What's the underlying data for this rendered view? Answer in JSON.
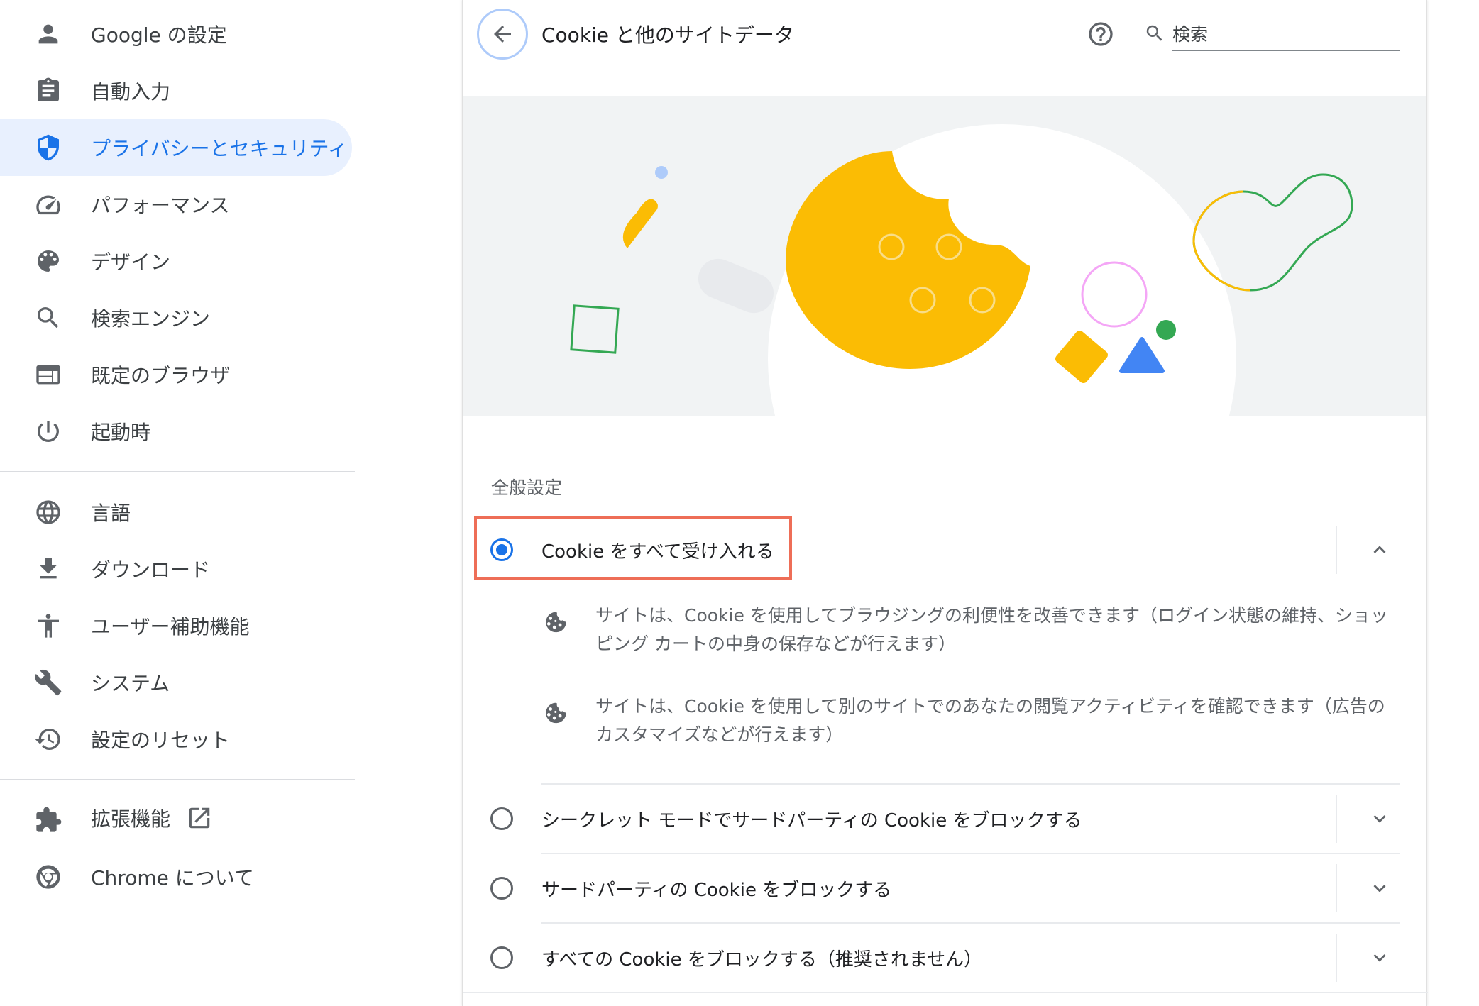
{
  "sidebar": {
    "items": [
      {
        "label": "Google の設定",
        "icon": "person-icon"
      },
      {
        "label": "自動入力",
        "icon": "clipboard-icon"
      },
      {
        "label": "プライバシーとセキュリティ",
        "icon": "shield-icon",
        "active": true
      },
      {
        "label": "パフォーマンス",
        "icon": "speedometer-icon"
      },
      {
        "label": "デザイン",
        "icon": "palette-icon"
      },
      {
        "label": "検索エンジン",
        "icon": "search-icon"
      },
      {
        "label": "既定のブラウザ",
        "icon": "browser-window-icon"
      },
      {
        "label": "起動時",
        "icon": "power-icon"
      },
      {
        "label": "言語",
        "icon": "globe-icon"
      },
      {
        "label": "ダウンロード",
        "icon": "download-icon"
      },
      {
        "label": "ユーザー補助機能",
        "icon": "accessibility-icon"
      },
      {
        "label": "システム",
        "icon": "wrench-icon"
      },
      {
        "label": "設定のリセット",
        "icon": "history-icon"
      },
      {
        "label": "拡張機能",
        "icon": "puzzle-icon",
        "external": true
      },
      {
        "label": "Chrome について",
        "icon": "chrome-icon"
      }
    ]
  },
  "header": {
    "title": "Cookie と他のサイトデータ",
    "search_placeholder": "検索"
  },
  "section_label": "全般設定",
  "options": [
    {
      "label": "Cookie をすべて受け入れる",
      "selected": true,
      "expanded": true
    },
    {
      "label": "シークレット モードでサードパーティの Cookie をブロックする",
      "selected": false,
      "expanded": false
    },
    {
      "label": "サードパーティの Cookie をブロックする",
      "selected": false,
      "expanded": false
    },
    {
      "label": "すべての Cookie をブロックする（推奨されません）",
      "selected": false,
      "expanded": false
    }
  ],
  "details": [
    {
      "text": "サイトは、Cookie を使用してブラウジングの利便性を改善できます（ログイン状態の維持、ショッピング カートの中身の保存などが行えます）",
      "icon": "cookie-icon"
    },
    {
      "text": "サイトは、Cookie を使用して別のサイトでのあなたの閲覧アクティビティを確認できます（広告のカスタマイズなどが行えます）",
      "icon": "cookie-icon"
    }
  ],
  "colors": {
    "accent": "#1a73e8",
    "active_bg": "#e8f0fe",
    "highlight_border": "#ee6e57",
    "cookie_yellow": "#fbbc04"
  }
}
